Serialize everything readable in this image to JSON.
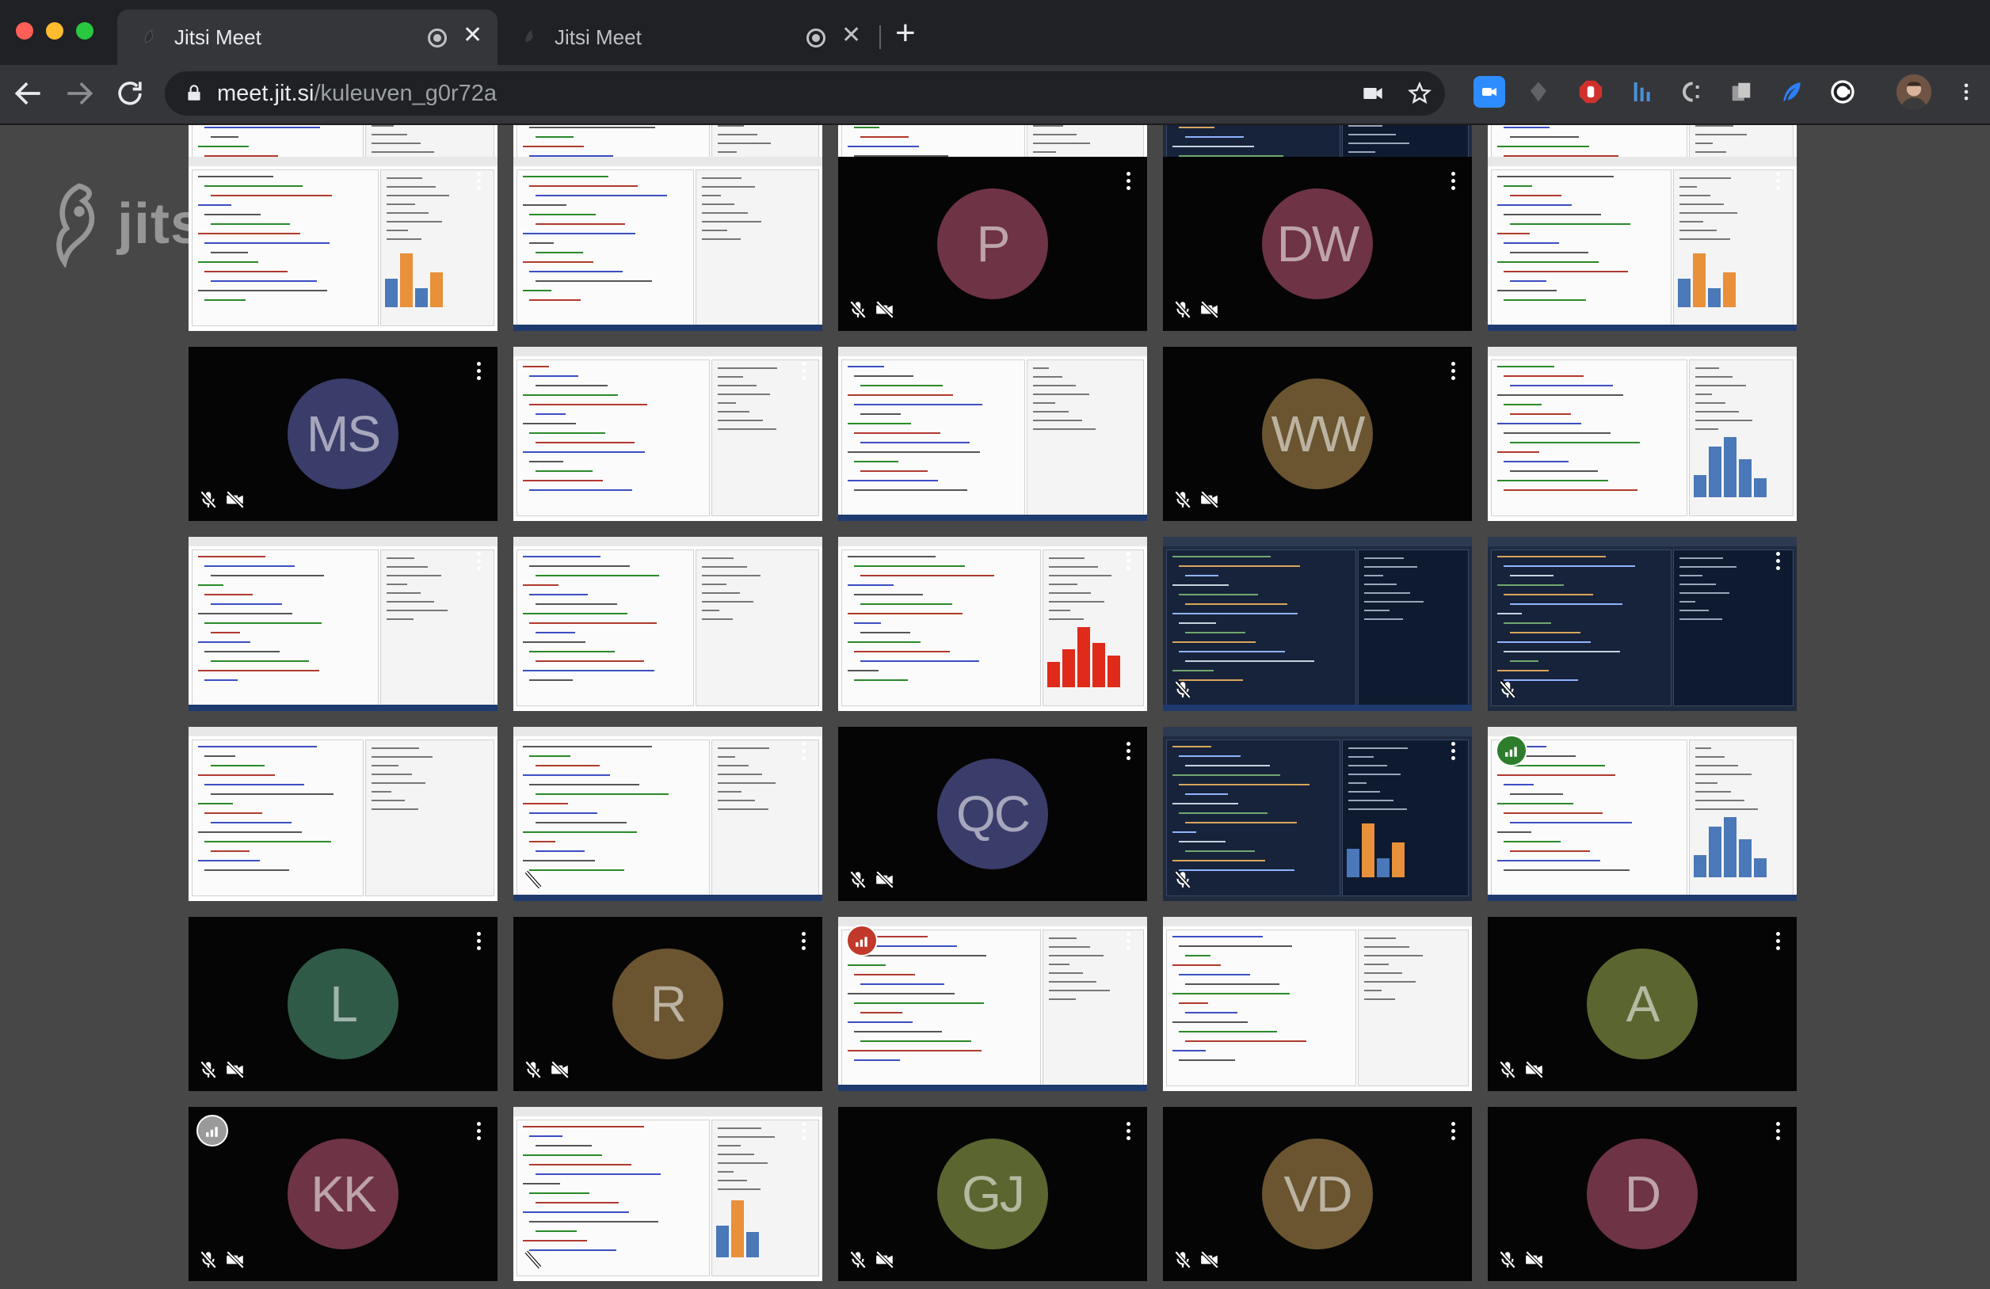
{
  "browser": {
    "tabs": [
      {
        "title": "Jitsi Meet",
        "active": true
      },
      {
        "title": "Jitsi Meet",
        "active": false
      }
    ],
    "new_tab_glyph": "+",
    "close_glyph": "✕",
    "url_host": "meet.jit.si",
    "url_path": "/kuleuven_g0r72a",
    "extensions": [
      "zoom-icon",
      "puzzle-icon",
      "adblock-icon",
      "bars-icon",
      "cc-icon",
      "copy-icon",
      "feather-icon",
      "grammarly-icon",
      "profile-avatar"
    ],
    "colors": {
      "tabstrip": "#202124",
      "toolbar": "#35363a",
      "red": "#ff5f57",
      "yellow": "#febc2e",
      "green": "#28c840"
    }
  },
  "watermark": {
    "text": "jitsi"
  },
  "tiles": [
    {
      "type": "share",
      "theme": "light",
      "muted": false
    },
    {
      "type": "share",
      "theme": "light",
      "muted": false
    },
    {
      "type": "share",
      "theme": "light",
      "muted": false
    },
    {
      "type": "share",
      "theme": "dark",
      "muted": false
    },
    {
      "type": "share",
      "theme": "light",
      "muted": false
    },
    {
      "type": "share",
      "theme": "light",
      "chart": "bars-orange",
      "muted": false
    },
    {
      "type": "share",
      "theme": "light",
      "muted": false
    },
    {
      "type": "avatar",
      "initials": "P",
      "color": "#6e3344",
      "muted": true
    },
    {
      "type": "avatar",
      "initials": "DW",
      "color": "#6e3344",
      "muted": true
    },
    {
      "type": "share",
      "theme": "light",
      "chart": "bars-orange",
      "muted": false
    },
    {
      "type": "avatar",
      "initials": "MS",
      "color": "#3a3c6a",
      "muted": true
    },
    {
      "type": "share",
      "theme": "light",
      "muted": false
    },
    {
      "type": "share",
      "theme": "light",
      "muted": false
    },
    {
      "type": "avatar",
      "initials": "WW",
      "color": "#6a5530",
      "muted": true
    },
    {
      "type": "share",
      "theme": "light",
      "chart": "hist-blue",
      "muted": false
    },
    {
      "type": "share",
      "theme": "light",
      "muted": false
    },
    {
      "type": "share",
      "theme": "light",
      "muted": false
    },
    {
      "type": "share",
      "theme": "light",
      "chart": "bars-red",
      "muted": false
    },
    {
      "type": "share",
      "theme": "dark",
      "muted": true
    },
    {
      "type": "share",
      "theme": "dark",
      "muted": true
    },
    {
      "type": "share",
      "theme": "light",
      "muted": false
    },
    {
      "type": "share",
      "theme": "light",
      "muted": true
    },
    {
      "type": "avatar",
      "initials": "QC",
      "color": "#3a3c6a",
      "muted": true
    },
    {
      "type": "share",
      "theme": "dark",
      "chart": "bars-orange",
      "muted": true
    },
    {
      "type": "share",
      "theme": "light",
      "chart": "hist-blue",
      "muted": false,
      "conn": "#2d7d2d"
    },
    {
      "type": "avatar",
      "initials": "L",
      "color": "#2f5a47",
      "muted": true
    },
    {
      "type": "avatar",
      "initials": "R",
      "color": "#6a5530",
      "muted": true
    },
    {
      "type": "share",
      "theme": "light",
      "muted": false,
      "conn": "#c0392b"
    },
    {
      "type": "share",
      "theme": "light",
      "muted": false
    },
    {
      "type": "avatar",
      "initials": "A",
      "color": "#5a6530",
      "muted": true
    },
    {
      "type": "avatar",
      "initials": "KK",
      "color": "#6e3344",
      "muted": true,
      "conn": "#9a9a9a"
    },
    {
      "type": "share",
      "theme": "light",
      "muted": true,
      "chart": "mini"
    },
    {
      "type": "avatar",
      "initials": "GJ",
      "color": "#5a6530",
      "muted": true
    },
    {
      "type": "avatar",
      "initials": "VD",
      "color": "#6a5530",
      "muted": true
    },
    {
      "type": "avatar",
      "initials": "D",
      "color": "#6e3344",
      "muted": true
    }
  ]
}
